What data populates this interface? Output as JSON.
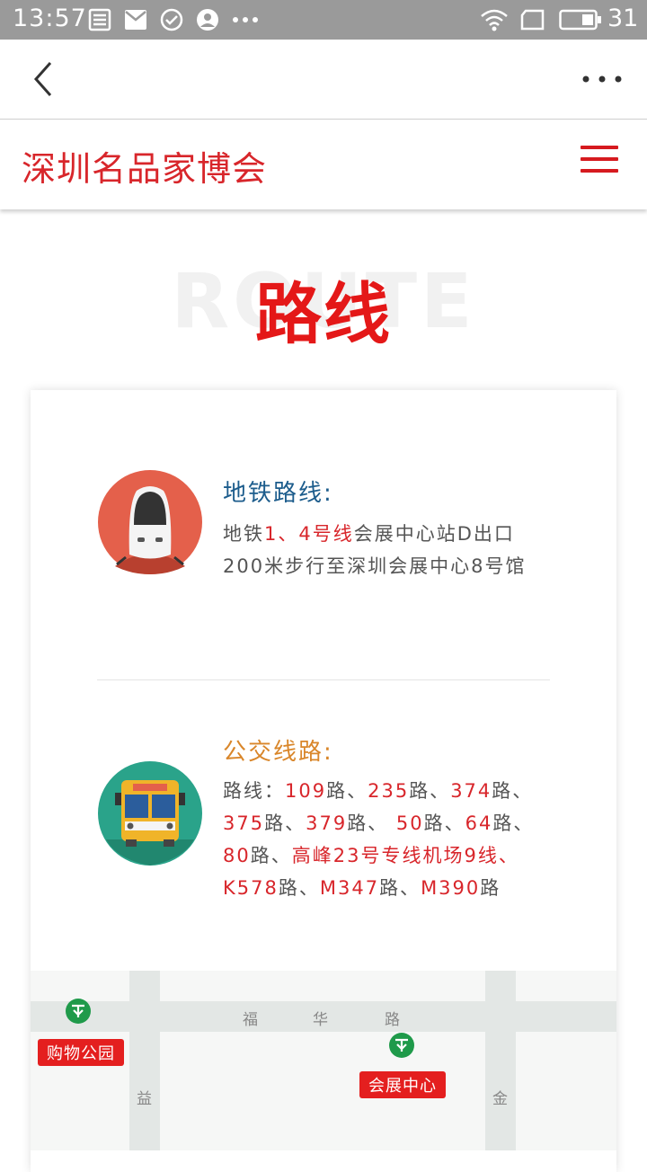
{
  "status_bar": {
    "time": "13:57",
    "battery_level": "31",
    "icons": [
      "sim-card-icon",
      "mail-icon",
      "check-circle-icon",
      "account-icon",
      "more-dots-icon",
      "wifi-icon",
      "sim-slot-icon",
      "battery-icon"
    ]
  },
  "nav": {
    "back_icon": "chevron-left-icon",
    "more_icon": "more-horizontal-icon"
  },
  "header": {
    "title": "深圳名品家博会",
    "menu_icon": "hamburger-menu-icon"
  },
  "section": {
    "bg_text": "ROUTE",
    "title": "路线"
  },
  "subway": {
    "heading": "地铁路线:",
    "lines_highlight": "1、4号线",
    "text_prefix": "地铁",
    "text_rest": "会展中心站D出口200米步行至深圳会展中心8号馆"
  },
  "bus": {
    "heading": "公交线路:",
    "prefix": "路线：",
    "routes_text": "109路、235路、374路、375路、379路、 50路、64路、 80路、高峰23号专线机场9线、K578路、M347路、M390路",
    "parts": [
      {
        "t": "109",
        "h": true
      },
      {
        "t": "路、",
        "h": false
      },
      {
        "t": "235",
        "h": true
      },
      {
        "t": "路、",
        "h": false
      },
      {
        "t": "374",
        "h": true
      },
      {
        "t": "路、",
        "h": false
      },
      {
        "t": "375",
        "h": true
      },
      {
        "t": "路、",
        "h": false
      },
      {
        "t": "379",
        "h": true
      },
      {
        "t": "路、 ",
        "h": false
      },
      {
        "t": "50",
        "h": true
      },
      {
        "t": "路、",
        "h": false
      },
      {
        "t": "64",
        "h": true
      },
      {
        "t": "路、 ",
        "h": false
      },
      {
        "t": "80",
        "h": true
      },
      {
        "t": "路、",
        "h": false
      },
      {
        "t": "高峰23号专线机场9线、K578",
        "h": true
      },
      {
        "t": "路、",
        "h": false
      },
      {
        "t": "M347",
        "h": true
      },
      {
        "t": "路、",
        "h": false
      },
      {
        "t": "M390",
        "h": true
      },
      {
        "t": "路",
        "h": false
      }
    ]
  },
  "map": {
    "road_fu": "福",
    "road_hua": "华",
    "road_lu": "路",
    "road_yi": "益",
    "road_jin": "金",
    "tag_shopping_park": "购物公园",
    "tag_convention_center": "会展中心",
    "colors": {
      "tag": "#e41f1f",
      "metro": "#1f9a4a"
    }
  },
  "colors": {
    "accent_red": "#d8262b",
    "subway_blue": "#1c5c8c",
    "bus_orange": "#d9862a"
  }
}
